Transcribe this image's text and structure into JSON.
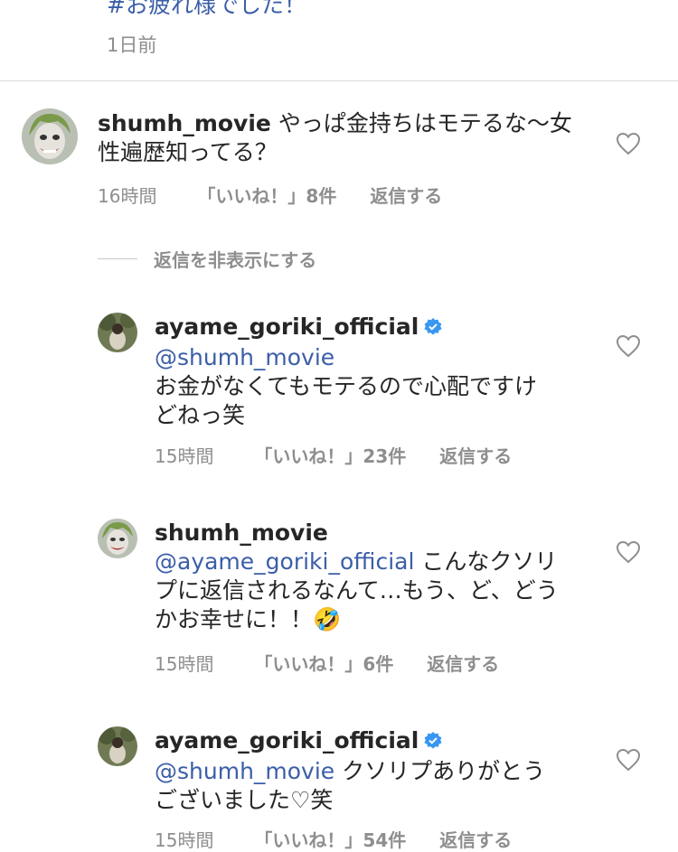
{
  "previous": {
    "text": "#お疲れ様でした！",
    "time": "1日前"
  },
  "comment": {
    "username": "shumh_movie",
    "text": "やっぱ金持ちはモテるな〜女性遍歴知ってる？",
    "line1": "やっぱ金持ちはモテるな〜女",
    "line2": "性遍歴知ってる？",
    "time": "16時間",
    "likes": "「いいね！」8件",
    "reply": "返信する"
  },
  "hide_replies": "返信を非表示にする",
  "replies": [
    {
      "username": "ayame_goriki_official",
      "verified": true,
      "mention": "@shumh_movie",
      "line1": "お金がなくてもモテるので心配ですけ",
      "line2": "どねっ笑",
      "time": "15時間",
      "likes": "「いいね！」23件",
      "reply": "返信する"
    },
    {
      "username": "shumh_movie",
      "verified": false,
      "mention": "@ayame_goriki_official",
      "line1_rest": " こんなクソリ",
      "line2": "プに返信されるなんて…もう、ど、どう",
      "line3": "かお幸せに！！🤣",
      "time": "15時間",
      "likes": "「いいね！」6件",
      "reply": "返信する"
    },
    {
      "username": "ayame_goriki_official",
      "verified": true,
      "mention": "@shumh_movie",
      "line1_rest": " クソリプありがとう",
      "line2": "ございました♡笑",
      "time": "15時間",
      "likes": "「いいね！」54件",
      "reply": "返信する"
    }
  ],
  "colors": {
    "link": "#3b5ea8",
    "meta": "#8e8e8e",
    "verified": "#3897f0",
    "text": "#262626"
  },
  "icons": {
    "like": "heart-outline-icon",
    "verified": "verified-badge-icon"
  }
}
